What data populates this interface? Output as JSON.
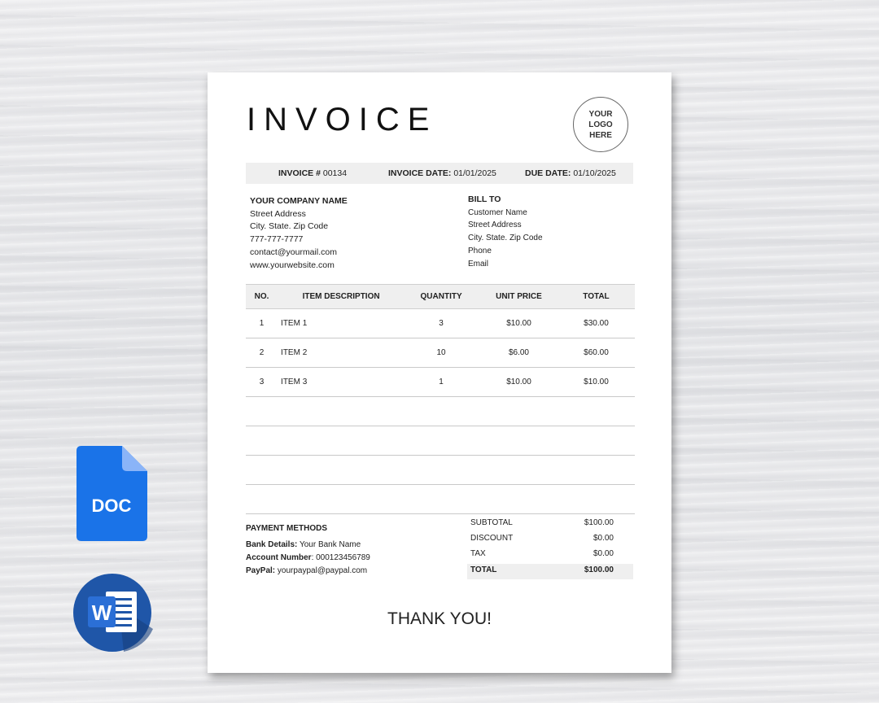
{
  "invoice": {
    "title": "INVOICE",
    "logo_lines": [
      "YOUR",
      "LOGO",
      "HERE"
    ],
    "meta": {
      "number_label": "INVOICE #",
      "number": "00134",
      "date_label": "INVOICE DATE:",
      "date": "01/01/2025",
      "due_label": "DUE DATE:",
      "due": "01/10/2025"
    },
    "from": {
      "company": "YOUR COMPANY NAME",
      "street": "Street Address",
      "city": "City. State. Zip Code",
      "phone": "777-777-7777",
      "email": "contact@yourmail.com",
      "website": "www.yourwebsite.com"
    },
    "bill_to": {
      "heading": "BILL TO",
      "name": "Customer Name",
      "street": "Street Address",
      "city": "City. State. Zip Code",
      "phone": "Phone",
      "email": "Email"
    },
    "table": {
      "headers": [
        "NO.",
        "ITEM DESCRIPTION",
        "QUANTITY",
        "UNIT PRICE",
        "TOTAL"
      ],
      "rows": [
        [
          "1",
          "ITEM 1",
          "3",
          "$10.00",
          "$30.00"
        ],
        [
          "2",
          "ITEM 2",
          "10",
          "$6.00",
          "$60.00"
        ],
        [
          "3",
          "ITEM 3",
          "1",
          "$10.00",
          "$10.00"
        ],
        [
          "",
          "",
          "",
          "",
          ""
        ],
        [
          "",
          "",
          "",
          "",
          ""
        ],
        [
          "",
          "",
          "",
          "",
          ""
        ],
        [
          "",
          "",
          "",
          "",
          ""
        ]
      ]
    },
    "payment": {
      "heading": "PAYMENT METHODS",
      "bank_label": "Bank Details:",
      "bank_value": "Your Bank Name",
      "account_label": "Account Number",
      "account_value": "000123456789",
      "paypal_label": "PayPal:",
      "paypal_value": "yourpaypal@paypal.com"
    },
    "totals": {
      "subtotal_label": "SUBTOTAL",
      "subtotal": "$100.00",
      "discount_label": "DISCOUNT",
      "discount": "$0.00",
      "tax_label": "TAX",
      "tax": "$0.00",
      "total_label": "TOTAL",
      "total": "$100.00"
    },
    "thanks": "THANK YOU!"
  },
  "badges": {
    "doc_label": "DOC",
    "word_letter": "W",
    "doc_color": "#1a73e8",
    "word_color": "#1f56a8"
  }
}
